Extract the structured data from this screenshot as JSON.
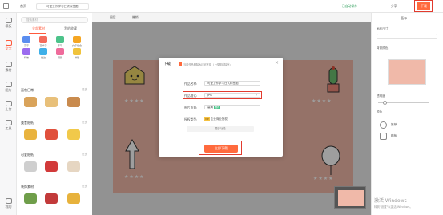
{
  "topbar": {
    "home": "首页",
    "file_title": "可爱工作学习日式标签图",
    "autosave": "已自动保存",
    "share": "分享",
    "download": "下载"
  },
  "canvas_tools": {
    "layer": "图层",
    "undo": "撤销"
  },
  "leftnav": [
    {
      "label": "模板",
      "active": false
    },
    {
      "label": "文字",
      "active": true
    },
    {
      "label": "素材",
      "active": false
    },
    {
      "label": "图片",
      "active": false
    },
    {
      "label": "上传",
      "active": false
    },
    {
      "label": "工具",
      "active": false
    },
    {
      "label": "我的",
      "active": false
    }
  ],
  "leftpanel": {
    "search_placeholder": "搜索素材",
    "tabs": [
      "全部素材",
      "我的收藏"
    ],
    "icon_row1": [
      "花字",
      "艺术字",
      "手写",
      "文字组合"
    ],
    "icon_row2": [
      "特效",
      "描边",
      "阴影",
      "排版"
    ],
    "sections": [
      {
        "title": "面包日常",
        "more": "更多"
      },
      {
        "title": "美食贴纸",
        "more": "更多"
      },
      {
        "title": "可爱贴纸",
        "more": "更多"
      },
      {
        "title": "装饰素材",
        "more": "更多"
      }
    ]
  },
  "canvas": {
    "background": "#f0b9a9",
    "star_text": "★★★★"
  },
  "modal": {
    "title": "下载",
    "checkbox_label": "当前作品删除水印可下载（上传图片除外）",
    "fields": [
      {
        "label": "作品名称:",
        "value": "可爱工作学习日式标签图"
      },
      {
        "label": "作品格式:",
        "value": "JPG"
      },
      {
        "label": "图片质量:",
        "value": "高清"
      },
      {
        "label": "授权类型:",
        "value": "企业商业授权"
      }
    ],
    "quality_badge": "推荐",
    "license_badge": "VIP",
    "more_options": "更多功能",
    "download_button": "立即下载",
    "close": "×"
  },
  "rightpanel": {
    "tab_canvas": "画布",
    "canvas_size_label": "画布尺寸",
    "bg_label": "背景颜色",
    "opacity_label": "透明度",
    "color_label": "颜色",
    "recommend_label": "推荐",
    "template_label": "模板"
  },
  "watermark": {
    "line1": "激活 Windows",
    "line2": "转到\"设置\"以激活 Windows。"
  },
  "colors": {
    "accent": "#ff5a3c",
    "highlight": "#e23b2e",
    "download": "#ff6a3d"
  }
}
